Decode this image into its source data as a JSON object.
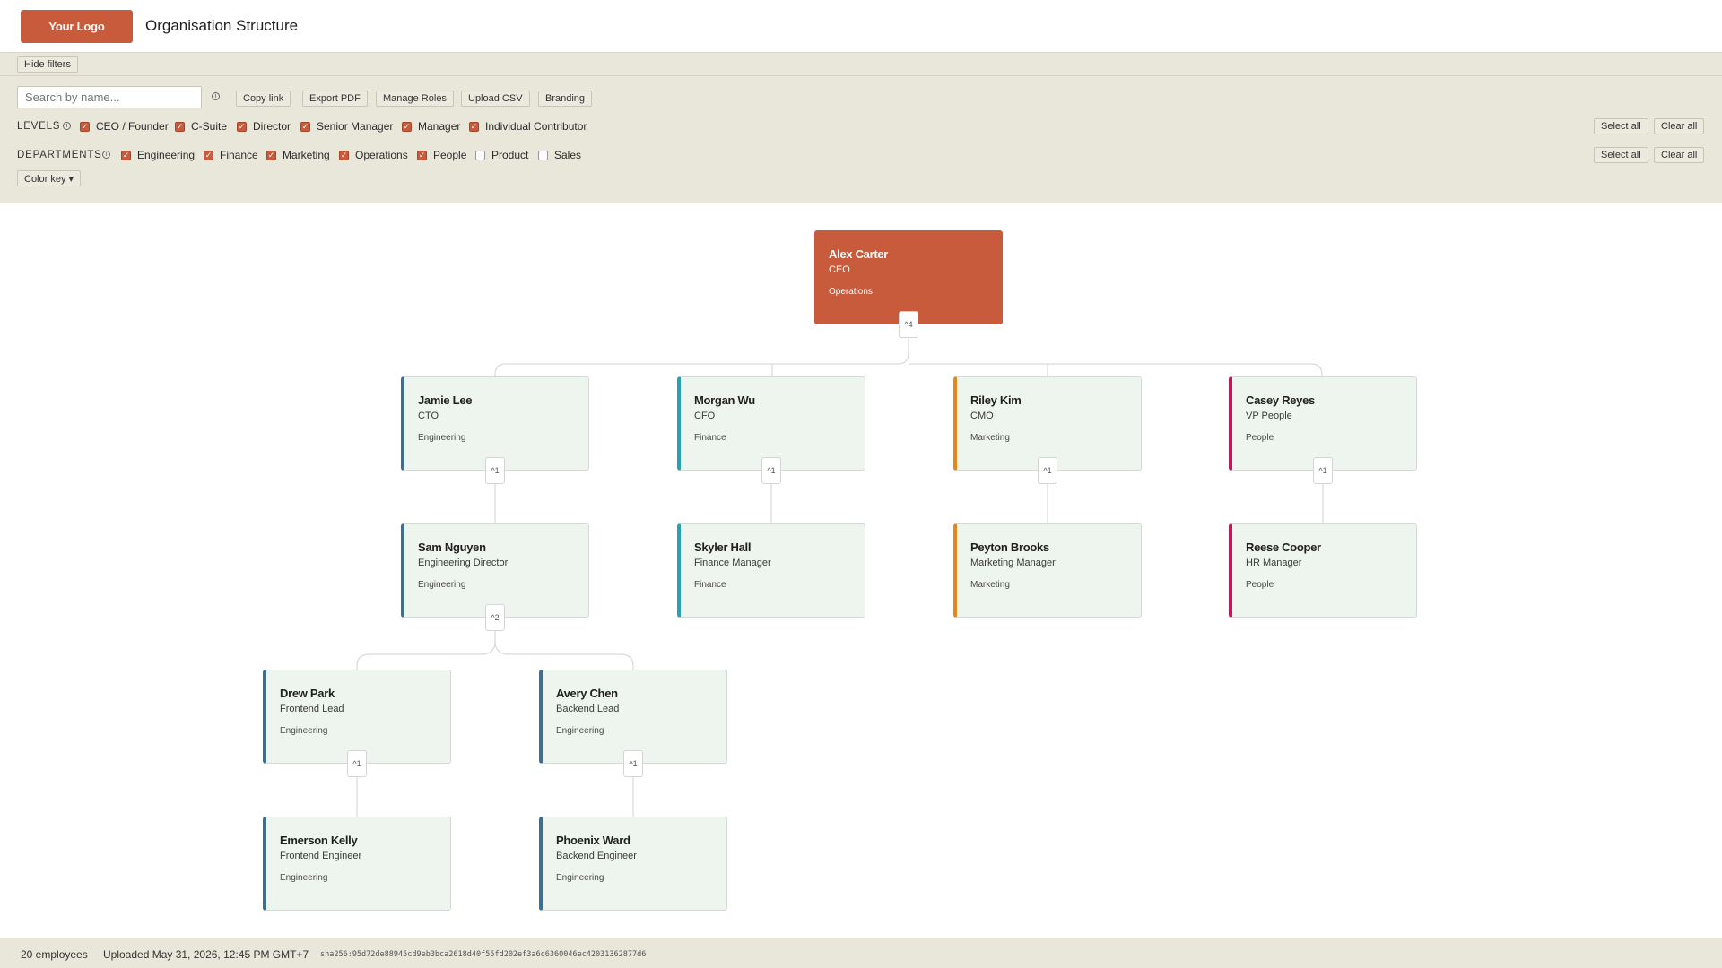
{
  "header": {
    "logo": "Your Logo",
    "title": "Organisation Structure"
  },
  "toolbar": {
    "hide_filters": "Hide filters",
    "search_placeholder": "Search by name...",
    "copy_link": "Copy link",
    "export_pdf": "Export PDF",
    "manage_roles": "Manage Roles",
    "upload_csv": "Upload CSV",
    "branding": "Branding",
    "color_key": "Color key ▾"
  },
  "levels": {
    "label": "LEVELS",
    "items": [
      {
        "label": "CEO / Founder",
        "checked": true
      },
      {
        "label": "C-Suite",
        "checked": true
      },
      {
        "label": "Director",
        "checked": true
      },
      {
        "label": "Senior Manager",
        "checked": true
      },
      {
        "label": "Manager",
        "checked": true
      },
      {
        "label": "Individual Contributor",
        "checked": true
      }
    ],
    "select_all": "Select all",
    "clear_all": "Clear all"
  },
  "departments": {
    "label": "DEPARTMENTS",
    "items": [
      {
        "label": "Engineering",
        "checked": true
      },
      {
        "label": "Finance",
        "checked": true
      },
      {
        "label": "Marketing",
        "checked": true
      },
      {
        "label": "Operations",
        "checked": true
      },
      {
        "label": "People",
        "checked": true
      },
      {
        "label": "Product",
        "checked": false
      },
      {
        "label": "Sales",
        "checked": false
      }
    ],
    "select_all": "Select all",
    "clear_all": "Clear all"
  },
  "dept_colors": {
    "Engineering": "#3d6f95",
    "Finance": "#2aa1b3",
    "Marketing": "#e08a1e",
    "People": "#c2185b",
    "Operations": "#c85b3b"
  },
  "org": {
    "ceo": {
      "name": "Alex Carter",
      "role": "CEO",
      "dept": "Operations",
      "toggle": "^4"
    },
    "cto": {
      "name": "Jamie Lee",
      "role": "CTO",
      "dept": "Engineering",
      "toggle": "^1"
    },
    "cfo": {
      "name": "Morgan Wu",
      "role": "CFO",
      "dept": "Finance",
      "toggle": "^1"
    },
    "cmo": {
      "name": "Riley Kim",
      "role": "CMO",
      "dept": "Marketing",
      "toggle": "^1"
    },
    "vp_people": {
      "name": "Casey Reyes",
      "role": "VP People",
      "dept": "People",
      "toggle": "^1"
    },
    "eng_dir": {
      "name": "Sam Nguyen",
      "role": "Engineering Director",
      "dept": "Engineering",
      "toggle": "^2"
    },
    "fin_mgr": {
      "name": "Skyler Hall",
      "role": "Finance Manager",
      "dept": "Finance"
    },
    "mkt_mgr": {
      "name": "Peyton Brooks",
      "role": "Marketing Manager",
      "dept": "Marketing"
    },
    "hr_mgr": {
      "name": "Reese Cooper",
      "role": "HR Manager",
      "dept": "People"
    },
    "fe_lead": {
      "name": "Drew Park",
      "role": "Frontend Lead",
      "dept": "Engineering",
      "toggle": "^1"
    },
    "be_lead": {
      "name": "Avery Chen",
      "role": "Backend Lead",
      "dept": "Engineering",
      "toggle": "^1"
    },
    "fe_eng": {
      "name": "Emerson Kelly",
      "role": "Frontend Engineer",
      "dept": "Engineering"
    },
    "be_eng": {
      "name": "Phoenix Ward",
      "role": "Backend Engineer",
      "dept": "Engineering"
    }
  },
  "footer": {
    "employees": "20 employees",
    "uploaded": "Uploaded May 31, 2026, 12:45 PM GMT+7",
    "hash": "sha256:95d72de88945cd9eb3bca2618d40f55fd202ef3a6c6360046ec42031362877d6"
  }
}
